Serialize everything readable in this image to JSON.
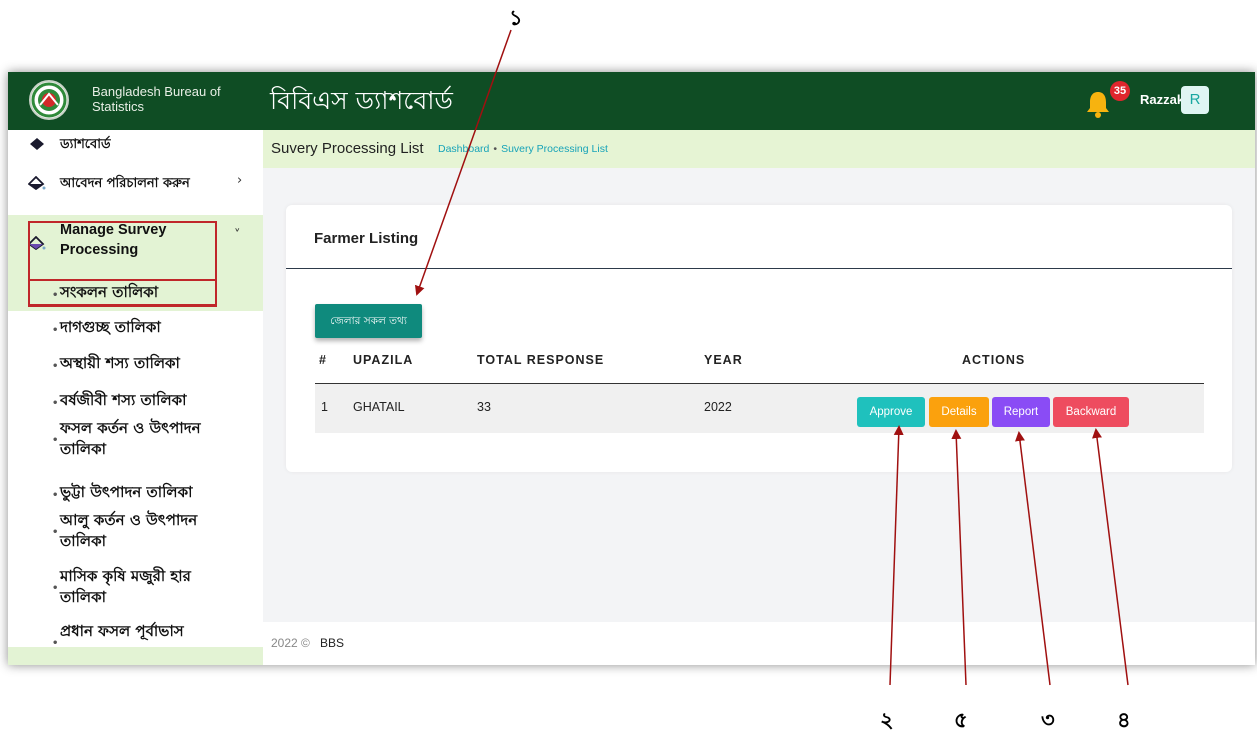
{
  "header": {
    "org_name": "Bangladesh Bureau of Statistics",
    "app_title": "বিবিএস ড্যাশবোর্ড",
    "notification_count": "35",
    "user_name": "Razzak",
    "avatar_initial": "R",
    "bar_color": "#0f4d24"
  },
  "sidebar": {
    "items": [
      {
        "label": "ড্যাশবোর্ড",
        "icon": "layers-icon"
      },
      {
        "label": "আবেদন পরিচালনা করুন",
        "icon": "drop-icon"
      },
      {
        "label": "Manage Survey Processing",
        "icon": "drop-icon"
      }
    ],
    "subitems": [
      "সংকলন তালিকা",
      "দাগগুচ্ছ তালিকা",
      "অস্থায়ী শস্য তালিকা",
      "বর্ষজীবী শস্য তালিকা",
      "ফসল কর্তন ও উৎপাদন তালিকা",
      "ভুট্টা উৎপাদন তালিকা",
      "আলু কর্তন ও উৎপাদন তালিকা",
      "মাসিক কৃষি মজুরী হার তালিকা",
      "প্রধান ফসল পূর্বাভাস"
    ]
  },
  "breadcrumb": {
    "title": "Suvery Processing List",
    "items": [
      "Dashboard",
      "Suvery Processing List"
    ]
  },
  "card": {
    "title": "Farmer Listing",
    "district_button": "জেলার সকল তথ্য",
    "columns": [
      "#",
      "UPAZILA",
      "TOTAL RESPONSE",
      "YEAR",
      "ACTIONS"
    ],
    "rows": [
      {
        "num": "1",
        "upazila": "GHATAIL",
        "total_response": "33",
        "year": "2022"
      }
    ],
    "actions": [
      {
        "label": "Approve",
        "color": "#1fc1bd"
      },
      {
        "label": "Details",
        "color": "#fba10d"
      },
      {
        "label": "Report",
        "color": "#8a4cf5"
      },
      {
        "label": "Backward",
        "color": "#ee4c5f"
      }
    ]
  },
  "footer": {
    "year": "2022 ©",
    "org": "BBS"
  },
  "annotations": {
    "labels": [
      "১",
      "২",
      "৫",
      "৩",
      "৪"
    ],
    "arrow_color": "#a01010"
  }
}
